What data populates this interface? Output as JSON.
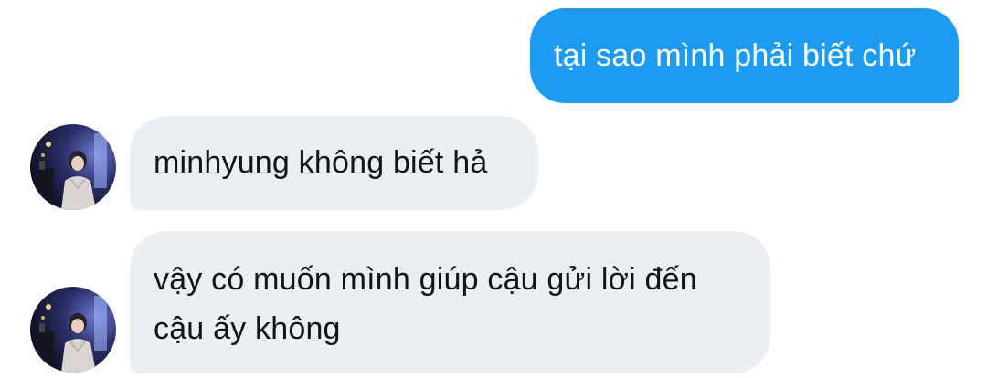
{
  "conversation": {
    "messages": [
      {
        "direction": "outgoing",
        "text": "tại sao mình phải biết chứ"
      },
      {
        "direction": "incoming",
        "text": "minhyung không biết hả"
      },
      {
        "direction": "incoming",
        "text": "vậy có muốn mình giúp cậu gửi lời đến cậu ấy không"
      }
    ]
  },
  "colors": {
    "outgoing_bubble": "#1d9bf0",
    "incoming_bubble": "#eceff2",
    "incoming_text": "#0f1419",
    "outgoing_text": "#ffffff"
  },
  "icons": {
    "sender_avatar": "user-avatar-photo"
  }
}
